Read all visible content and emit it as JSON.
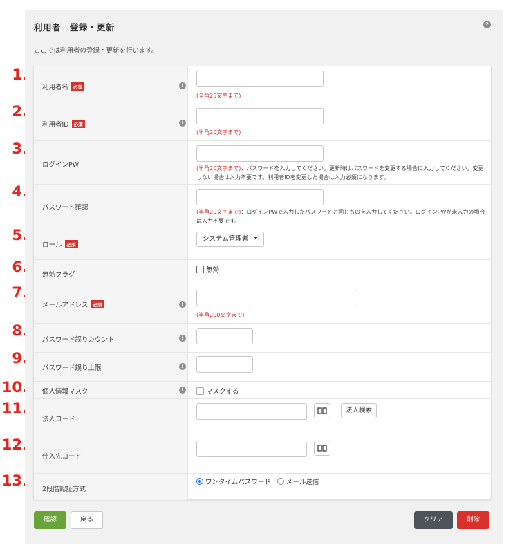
{
  "page": {
    "title": "利用者　登録・更新",
    "help_icon": "?",
    "description": "ここでは利用者の登録・更新を行います。"
  },
  "required_badge": "必須",
  "info_icon": "i",
  "markers": [
    "1.",
    "2.",
    "3.",
    "4.",
    "5.",
    "6.",
    "7.",
    "8.",
    "9.",
    "10.",
    "11.",
    "12.",
    "13."
  ],
  "fields": {
    "user_name": {
      "label": "利用者名",
      "value": "",
      "hint": "(全角25文字まで)"
    },
    "user_id": {
      "label": "利用者ID",
      "value": "",
      "hint": "(半角20文字まで)"
    },
    "login_pw": {
      "label": "ログインPW",
      "value": "",
      "hint_red": "(半角20文字まで)",
      "hint_text": "：パスワードを入力してください。更新時はパスワードを変更する場合に入力してください。変更しない場合は入力不要です。利用者IDを変更した場合は入力必須になります。"
    },
    "pw_confirm": {
      "label": "パスワード確認",
      "value": "",
      "hint_red": "(半角20文字まで)",
      "hint_text": "：ログインPWで入力したパスワードと同じものを入力してください。ログインPWが未入力の場合は入力不要です。"
    },
    "role": {
      "label": "ロール",
      "selected": "システム管理者"
    },
    "disabled_flag": {
      "label": "無効フラグ",
      "checkbox_label": "無効",
      "checked": false
    },
    "email": {
      "label": "メールアドレス",
      "value": "",
      "hint": "(半角200文字まで)"
    },
    "pw_error_count": {
      "label": "パスワード誤りカウント",
      "value": ""
    },
    "pw_error_limit": {
      "label": "パスワード誤り上限",
      "value": ""
    },
    "pii_mask": {
      "label": "個人情報マスク",
      "checkbox_label": "マスクする",
      "checked": false
    },
    "corp_code": {
      "label": "法人コード",
      "value": "",
      "search_label": "法人検索",
      "book_icon": "book-icon"
    },
    "supplier_code": {
      "label": "仕入先コード",
      "value": "",
      "book_icon": "book-icon"
    },
    "two_factor": {
      "label": "2段階認証方式",
      "options": [
        "ワンタイムパスワード",
        "メール送信"
      ],
      "selected": "ワンタイムパスワード"
    }
  },
  "actions": {
    "confirm": "確認",
    "back": "戻る",
    "clear": "クリア",
    "delete": "削除"
  },
  "colors": {
    "required": "#d9302a",
    "hint_red": "#d9302a",
    "confirm": "#6ba53a",
    "clear": "#4d5459",
    "delete": "#d9302a",
    "marker": "#e8231e"
  }
}
